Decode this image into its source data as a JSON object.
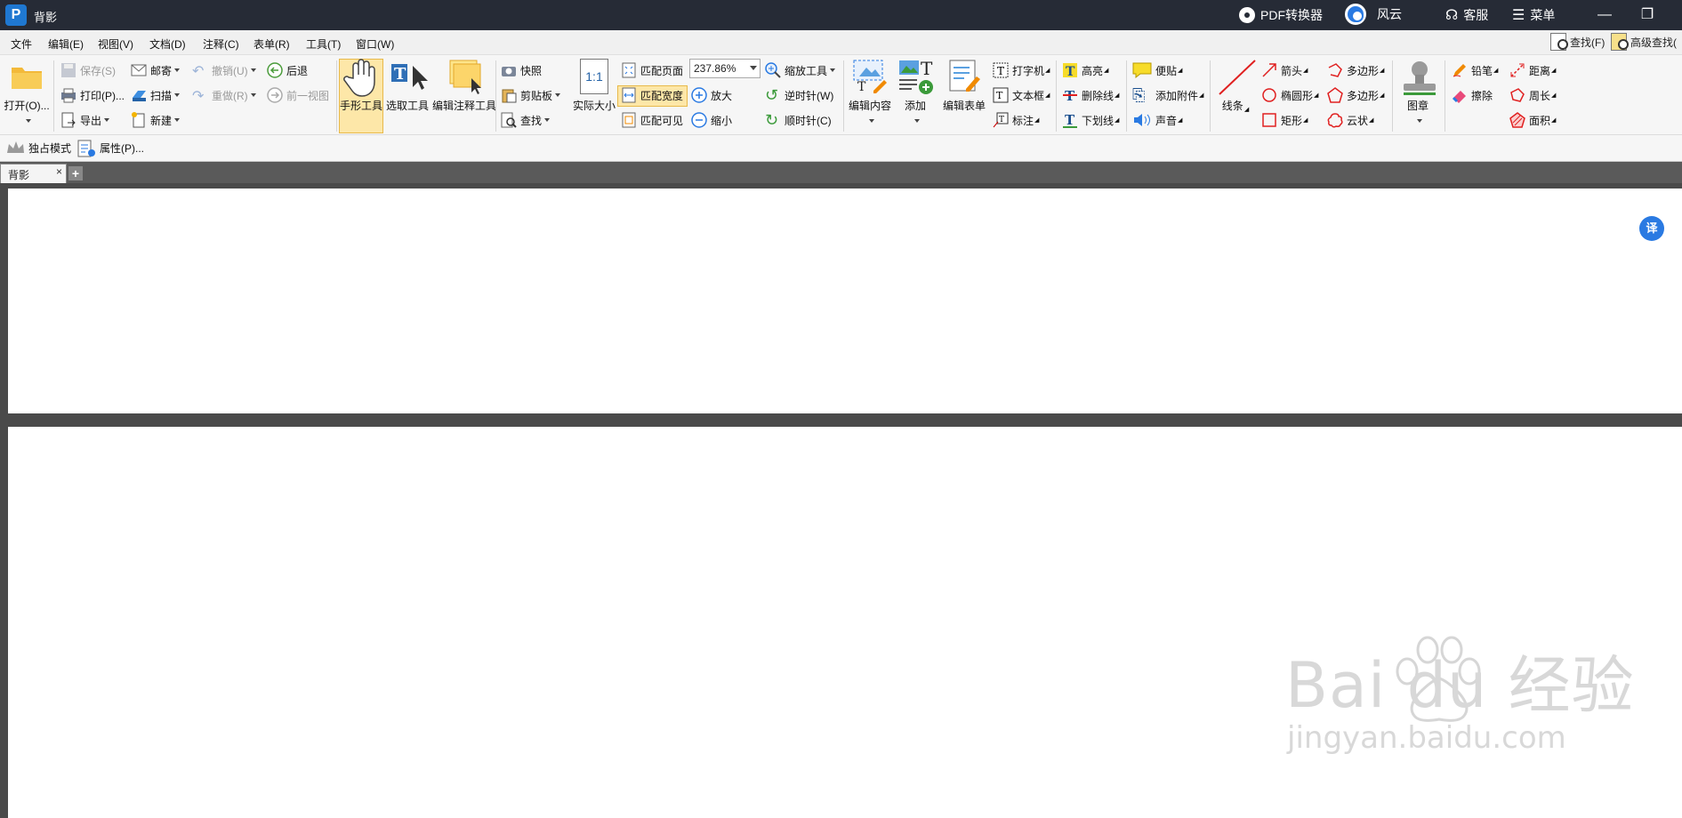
{
  "titlebar": {
    "logo": "P",
    "title": "背影",
    "pdf_converter": "PDF转换器",
    "user": "风云",
    "support": "客服",
    "menu": "菜单"
  },
  "menubar": {
    "items": [
      "文件",
      "编辑(E)",
      "视图(V)",
      "文档(D)",
      "注释(C)",
      "表单(R)",
      "工具(T)",
      "窗口(W)"
    ],
    "find": "查找(F)",
    "advanced_find": "高级查找("
  },
  "toolbar": {
    "open": "打开(O)...",
    "save": "保存(S)",
    "print": "打印(P)...",
    "export": "导出",
    "mail": "邮寄",
    "scan": "扫描",
    "new": "新建",
    "undo": "撤销(U)",
    "redo": "重做(R)",
    "back": "后退",
    "prev_view": "前一视图",
    "hand_tool": "手形工具",
    "select_tool": "选取工具",
    "edit_annot_tool": "编辑注释工具",
    "snapshot": "快照",
    "clipboard": "剪贴板",
    "find": "查找",
    "actual_size": "实际大小",
    "actual_size_icon": "1:1",
    "fit_page": "匹配页面",
    "fit_width": "匹配宽度",
    "fit_visible": "匹配可见",
    "zoom_value": "237.86%",
    "zoom_in": "放大",
    "zoom_out": "缩小",
    "zoom_tool": "缩放工具",
    "rotate_ccw": "逆时针(W)",
    "rotate_cw": "顺时针(C)",
    "edit_content": "编辑内容",
    "add": "添加",
    "edit_form": "编辑表单",
    "typewriter": "打字机",
    "textbox": "文本框",
    "callout": "标注",
    "highlight": "高亮",
    "strikeout": "删除线",
    "underline": "下划线",
    "note": "便贴",
    "attach": "添加附件",
    "sound": "声音",
    "line": "线条",
    "arrow": "箭头",
    "ellipse": "椭圆形",
    "rectangle": "矩形",
    "polygon1": "多边形",
    "polygon2": "多边形",
    "cloud": "云状",
    "stamp": "图章",
    "pencil": "铅笔",
    "eraser": "擦除",
    "distance": "距离",
    "perimeter": "周长",
    "area": "面积"
  },
  "subbar": {
    "exclusive_mode": "独占模式",
    "properties": "属性(P)..."
  },
  "tabs": [
    {
      "label": "背影",
      "close": "×"
    }
  ],
  "add_tab": "+",
  "watermark": {
    "line1": "Bai  du 经验",
    "line2": "jingyan.baidu.com"
  },
  "colors": {
    "titlebar": "#262b36",
    "accent": "#2a7ae2",
    "active_tool": "#fde7a8"
  }
}
